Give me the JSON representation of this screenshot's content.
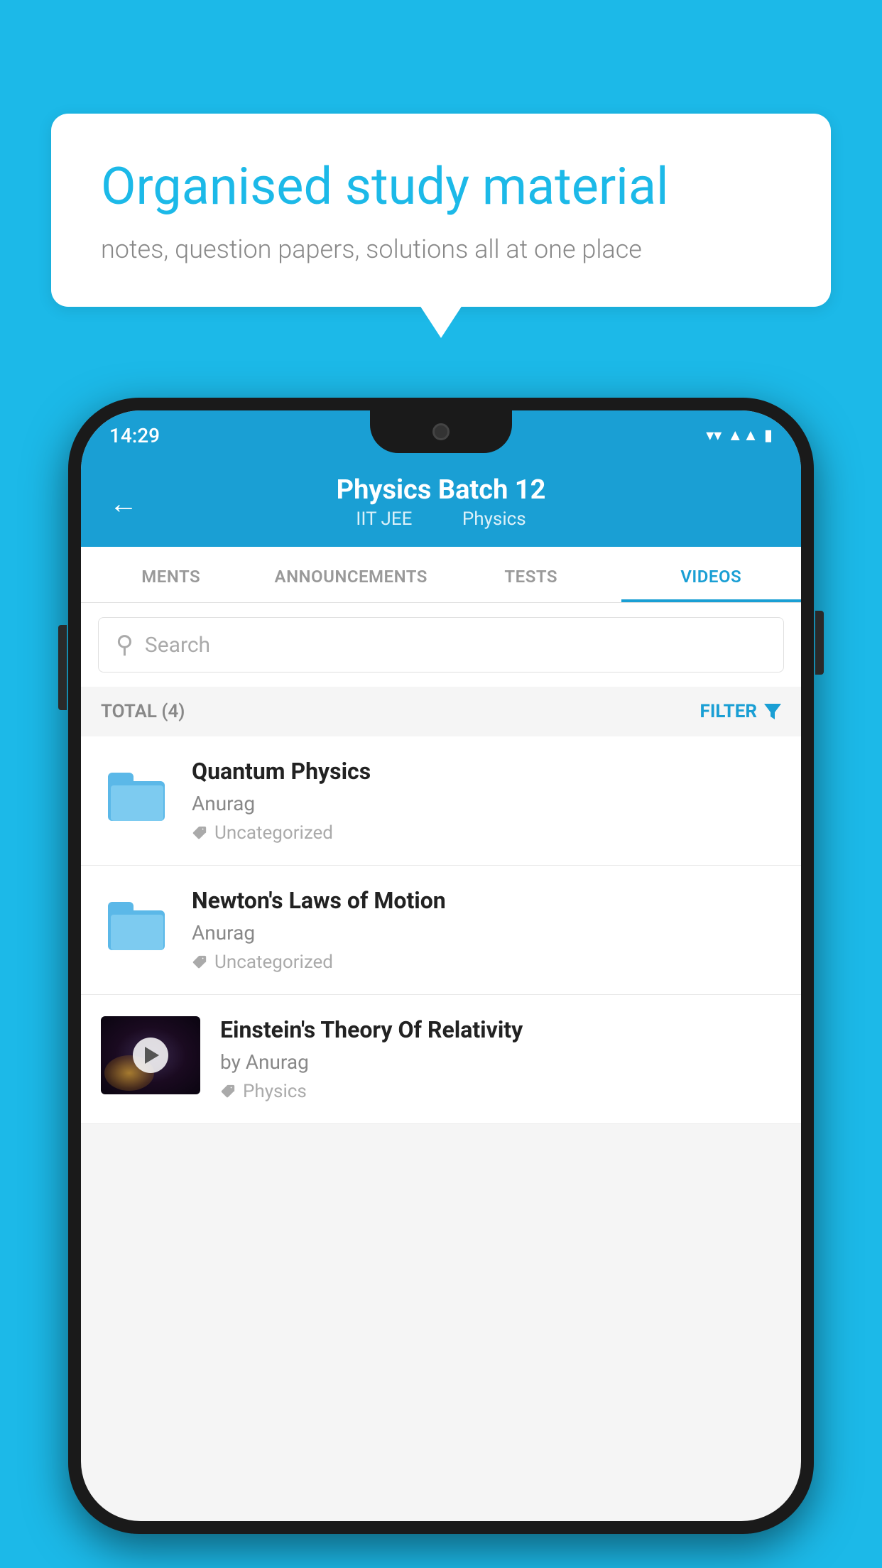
{
  "background_color": "#1CB9E8",
  "speech_bubble": {
    "title": "Organised study material",
    "subtitle": "notes, question papers, solutions all at one place"
  },
  "phone": {
    "status_bar": {
      "time": "14:29",
      "icons": [
        "wifi",
        "signal",
        "battery"
      ]
    },
    "app_bar": {
      "back_label": "←",
      "title": "Physics Batch 12",
      "subtitle_part1": "IIT JEE",
      "subtitle_part2": "Physics"
    },
    "tabs": [
      {
        "label": "MENTS",
        "active": false
      },
      {
        "label": "ANNOUNCEMENTS",
        "active": false
      },
      {
        "label": "TESTS",
        "active": false
      },
      {
        "label": "VIDEOS",
        "active": true
      }
    ],
    "search": {
      "placeholder": "Search"
    },
    "filter_bar": {
      "total_label": "TOTAL (4)",
      "filter_label": "FILTER"
    },
    "video_list": [
      {
        "id": 1,
        "title": "Quantum Physics",
        "author": "Anurag",
        "tag": "Uncategorized",
        "has_thumb": false
      },
      {
        "id": 2,
        "title": "Newton's Laws of Motion",
        "author": "Anurag",
        "tag": "Uncategorized",
        "has_thumb": false
      },
      {
        "id": 3,
        "title": "Einstein's Theory Of Relativity",
        "author": "by Anurag",
        "tag": "Physics",
        "has_thumb": true
      }
    ]
  }
}
